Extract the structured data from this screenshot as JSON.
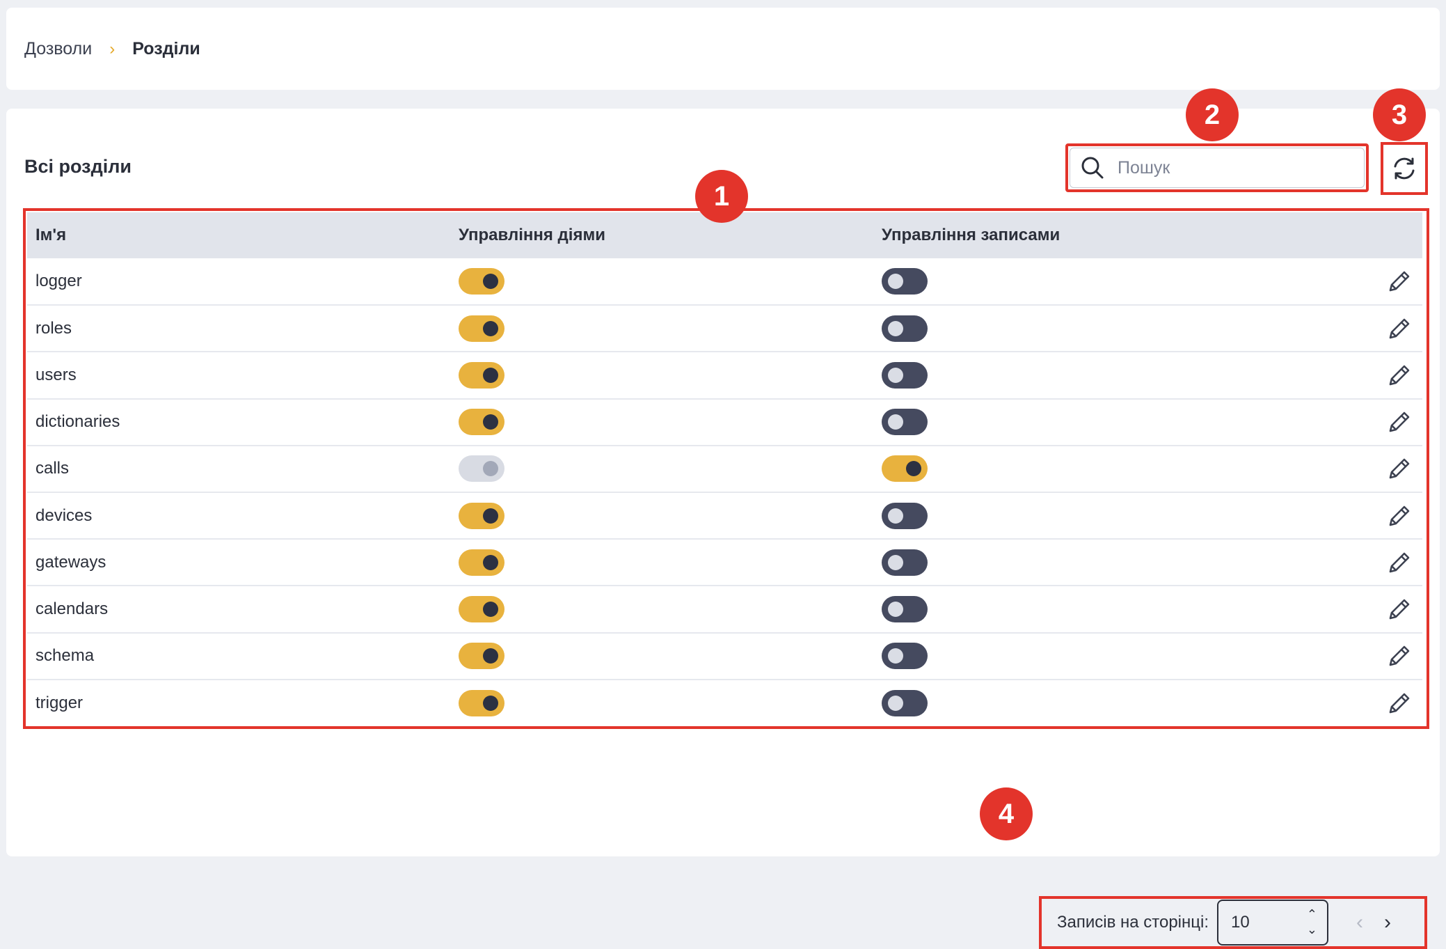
{
  "breadcrumb": {
    "parent": "Дозволи",
    "separator": "›",
    "current": "Розділи"
  },
  "section_title": "Всі розділи",
  "search": {
    "placeholder": "Пошук",
    "value": ""
  },
  "table": {
    "columns": [
      "Ім'я",
      "Управління діями",
      "Управління записами"
    ],
    "rows": [
      {
        "name": "logger",
        "actions": "on",
        "records": "off"
      },
      {
        "name": "roles",
        "actions": "on",
        "records": "off"
      },
      {
        "name": "users",
        "actions": "on",
        "records": "off"
      },
      {
        "name": "dictionaries",
        "actions": "on",
        "records": "off"
      },
      {
        "name": "calls",
        "actions": "disabled",
        "records": "on"
      },
      {
        "name": "devices",
        "actions": "on",
        "records": "off"
      },
      {
        "name": "gateways",
        "actions": "on",
        "records": "off"
      },
      {
        "name": "calendars",
        "actions": "on",
        "records": "off"
      },
      {
        "name": "schema",
        "actions": "on",
        "records": "off"
      },
      {
        "name": "trigger",
        "actions": "on",
        "records": "off"
      }
    ]
  },
  "pagination": {
    "per_page_label": "Записів на сторінці:",
    "per_page_value": "10",
    "prev_icon": "chevron-left-icon",
    "next_icon": "chevron-right-icon"
  },
  "annotations": {
    "badge_1": "1",
    "badge_2": "2",
    "badge_3": "3",
    "badge_4": "4"
  },
  "colors": {
    "accent_yellow": "#e8b23e",
    "toggle_off": "#454a5f",
    "annotation_red": "#e3342b",
    "header_bg": "#e1e4eb"
  }
}
